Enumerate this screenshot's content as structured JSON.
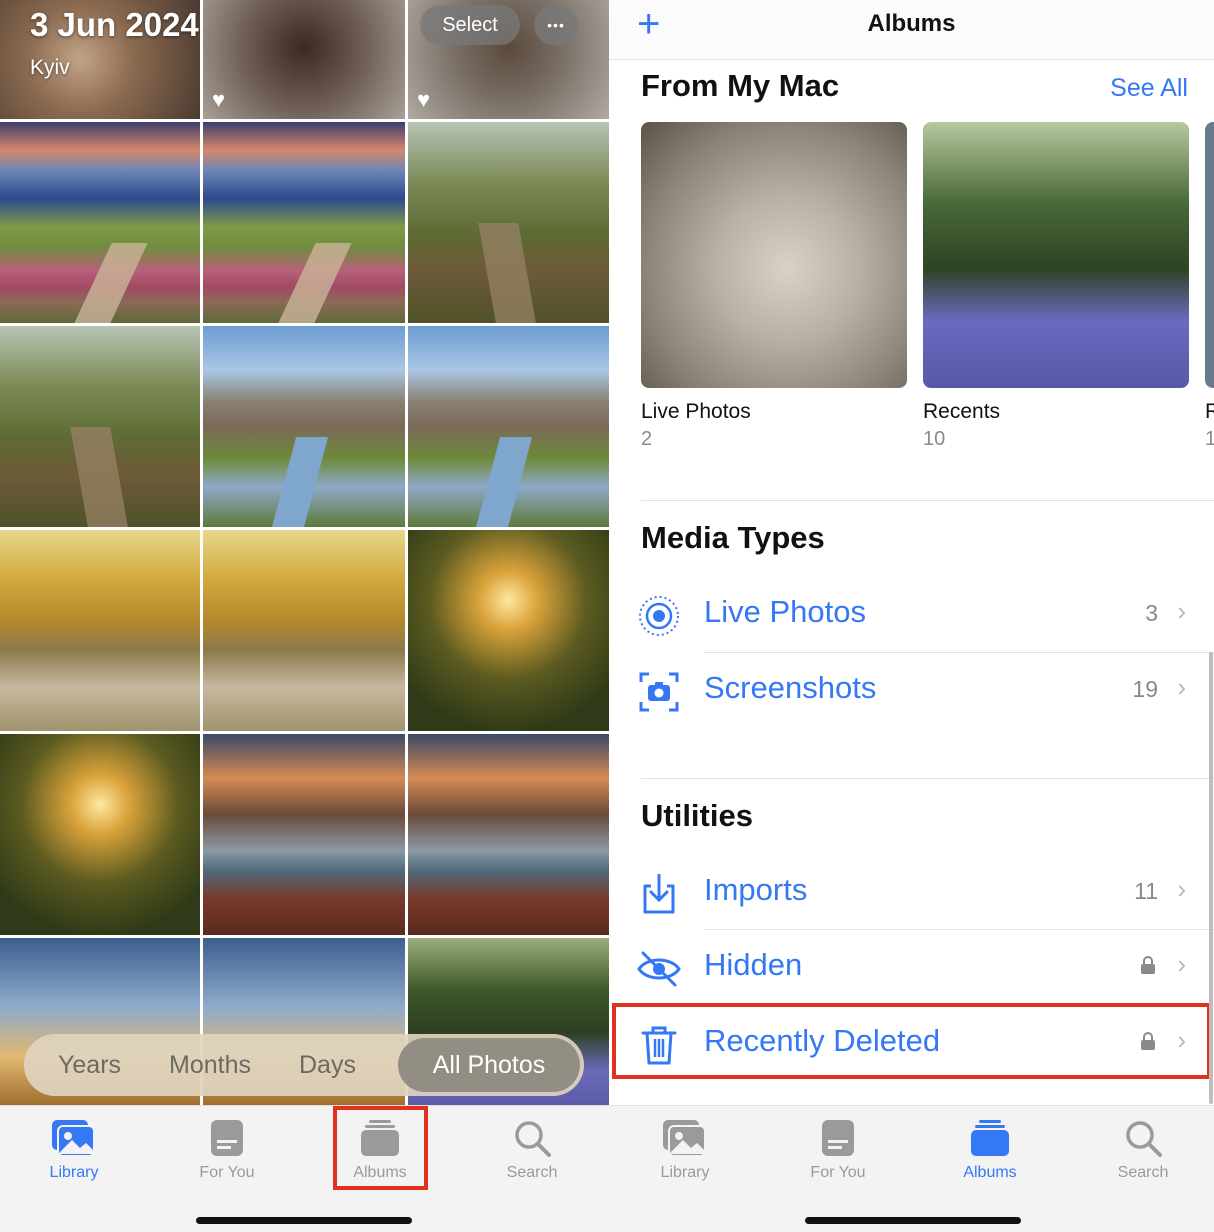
{
  "left": {
    "header": {
      "date": "3 Jun 2024",
      "place": "Kyiv",
      "select_label": "Select",
      "more_label": "•••"
    },
    "view_switcher": {
      "items": [
        "Years",
        "Months",
        "Days"
      ],
      "active": "All Photos"
    },
    "tabbar": {
      "items": [
        "Library",
        "For You",
        "Albums",
        "Search"
      ],
      "active": "Library"
    }
  },
  "right": {
    "nav": {
      "title": "Albums",
      "add_icon": "plus-icon"
    },
    "from_my_mac": {
      "title": "From My Mac",
      "see_all": "See All",
      "albums": [
        {
          "name": "Live Photos",
          "count": "2"
        },
        {
          "name": "Recents",
          "count": "10"
        },
        {
          "name": "R",
          "count": "1"
        }
      ]
    },
    "media_types": {
      "title": "Media Types",
      "rows": [
        {
          "label": "Live Photos",
          "count": "3",
          "icon": "live-photos-icon"
        },
        {
          "label": "Screenshots",
          "count": "19",
          "icon": "screenshot-icon"
        }
      ]
    },
    "utilities": {
      "title": "Utilities",
      "rows": [
        {
          "label": "Imports",
          "count": "11",
          "icon": "import-icon"
        },
        {
          "label": "Hidden",
          "count": "",
          "icon": "eye-slash-icon"
        },
        {
          "label": "Recently Deleted",
          "count": "",
          "icon": "trash-icon"
        }
      ]
    },
    "tabbar": {
      "items": [
        "Library",
        "For You",
        "Albums",
        "Search"
      ],
      "active": "Albums"
    }
  },
  "colors": {
    "accent": "#3478f6",
    "highlight": "#e0321e"
  }
}
